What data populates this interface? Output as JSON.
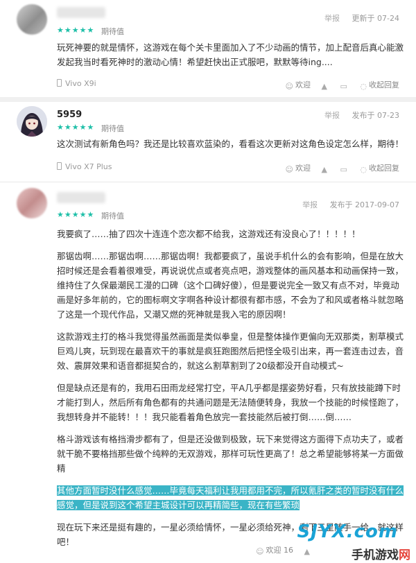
{
  "reviews": [
    {
      "user": "",
      "rating_text": "★★★★★",
      "rating_label": "期待值",
      "report": "举报",
      "date": "更新于 07-24",
      "paragraphs": [
        "玩死神要的就是情怀，这游戏在每个关卡里面加入了不少动画的情节，加上配音后真心能激发起我当时看死神时的激动心情！希望赶快出正式服吧，默默等待ing...."
      ],
      "device": "Vivo X9i",
      "actions": {
        "dislike": "欢迎",
        "like": "",
        "reply": "",
        "collapse": "收起回复"
      }
    },
    {
      "user": "5959",
      "rating_text": "★★★★★",
      "rating_label": "期待值",
      "report": "举报",
      "date": "发布于 07-23",
      "paragraphs": [
        "这次测试有新角色吗？我还是比较喜欢蓝染的，看看这次更新对这角色设定怎么样，期待！"
      ],
      "device": "Vivo X7 Plus",
      "actions": {
        "dislike": "欢迎",
        "like": "",
        "reply": "",
        "collapse": "收起回复"
      }
    },
    {
      "user": "",
      "rating_text": "★★★★★",
      "rating_label": "期待值",
      "report": "举报",
      "date": "发布于 2017-09-07",
      "paragraphs": [
        "我要疯了……抽了四次十连连个恋次都不给我，这游戏还有没良心了！！！！！",
        "那锯齿啊……那锯齿啊……那锯齿啊！我都要疯了，虽说手机什么的会有影响，但是在放大招时候还是会看着很难受，再说说优点或者亮点吧，游戏整体的画风基本和动画保持一致，维持住了久保最潮民工漫的口碑（这个口碑好傻），但是要说完全一致又有点不对，毕竟动画是好多年前的，它的图标啊文字啊各种设计都很有都市感，不会为了和风或者格斗就忽略了这是一个现代作品，又潮又燃的死神就是我入宅的原因啊！",
        "这款游戏主打的格斗我觉得虽然画面是类似拳皇，但是整体操作更偏向无双那类，割草模式巨鸡儿爽，玩到现在最喜欢干的事就是疯狂跑图然后把怪全吸引出来，再一套连击过去，音效、震屏效果和语音都挺契合的，就这么割草割到了20级都没开自动模式~",
        "但是缺点还是有的，我用石田雨龙经常打空，平A几乎都是摆姿势好看，只有放技能蹲下时才能打到人，然后所有角色都有的共通问题是无法随便转身，我放一个技能的时候怪跑了，我想转身并不能转！！！我只能看着角色放完一套技能然后被打倒……倒……",
        "格斗游戏该有格挡滑步都有了，但是还没做到极致，玩下来觉得这方面得下点功夫了，或者就干脆不要格挡那些做个纯粹的无双游戏，那样可玩性更高了！总之希望能够将某一方面做精",
        "其他方面暂时没什么感觉……毕竟每天福利让我用都用不完，所以氪肝之类的暂时没有什么感觉，但是说到这个希望主城设计可以再精简些，现在有些繁琐",
        "现在玩下来还是挺有趣的，一星必须给情怀，一星必须给死神，剩下三星随手一给，就这样吧！"
      ],
      "device": "",
      "actions": {
        "dislike": "欢迎 16",
        "like": "",
        "reply": "",
        "collapse": ""
      }
    }
  ],
  "watermark": {
    "domain": "SJYX.com",
    "site_name_black": "手机游戏",
    "site_name_red": "网"
  },
  "colors": {
    "accent": "#1ebfa8",
    "highlight": "#3ab4c6",
    "watermark_blue": "#1aa3d6"
  }
}
